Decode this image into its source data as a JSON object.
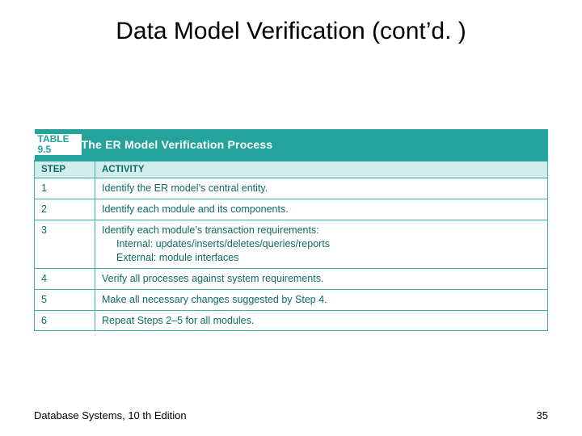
{
  "title": "Data Model Verification (cont’d. )",
  "table": {
    "label_top": "TABLE",
    "label_bottom": "9.5",
    "caption": "The ER Model Verification Process",
    "head_step": "STEP",
    "head_activity": "ACTIVITY",
    "rows": [
      {
        "step": "1",
        "activity": "Identify the ER model’s central entity."
      },
      {
        "step": "2",
        "activity": "Identify each module and its components."
      },
      {
        "step": "3",
        "activity": "Identify each module’s transaction requirements:",
        "sub1": "Internal: updates/inserts/deletes/queries/reports",
        "sub2": "External: module interfaces"
      },
      {
        "step": "4",
        "activity": "Verify all processes against system requirements."
      },
      {
        "step": "5",
        "activity": "Make all necessary changes suggested by Step 4."
      },
      {
        "step": "6",
        "activity": "Repeat Steps 2–5 for all modules."
      }
    ]
  },
  "footer_left": "Database Systems, 10 th Edition",
  "footer_right": "35"
}
